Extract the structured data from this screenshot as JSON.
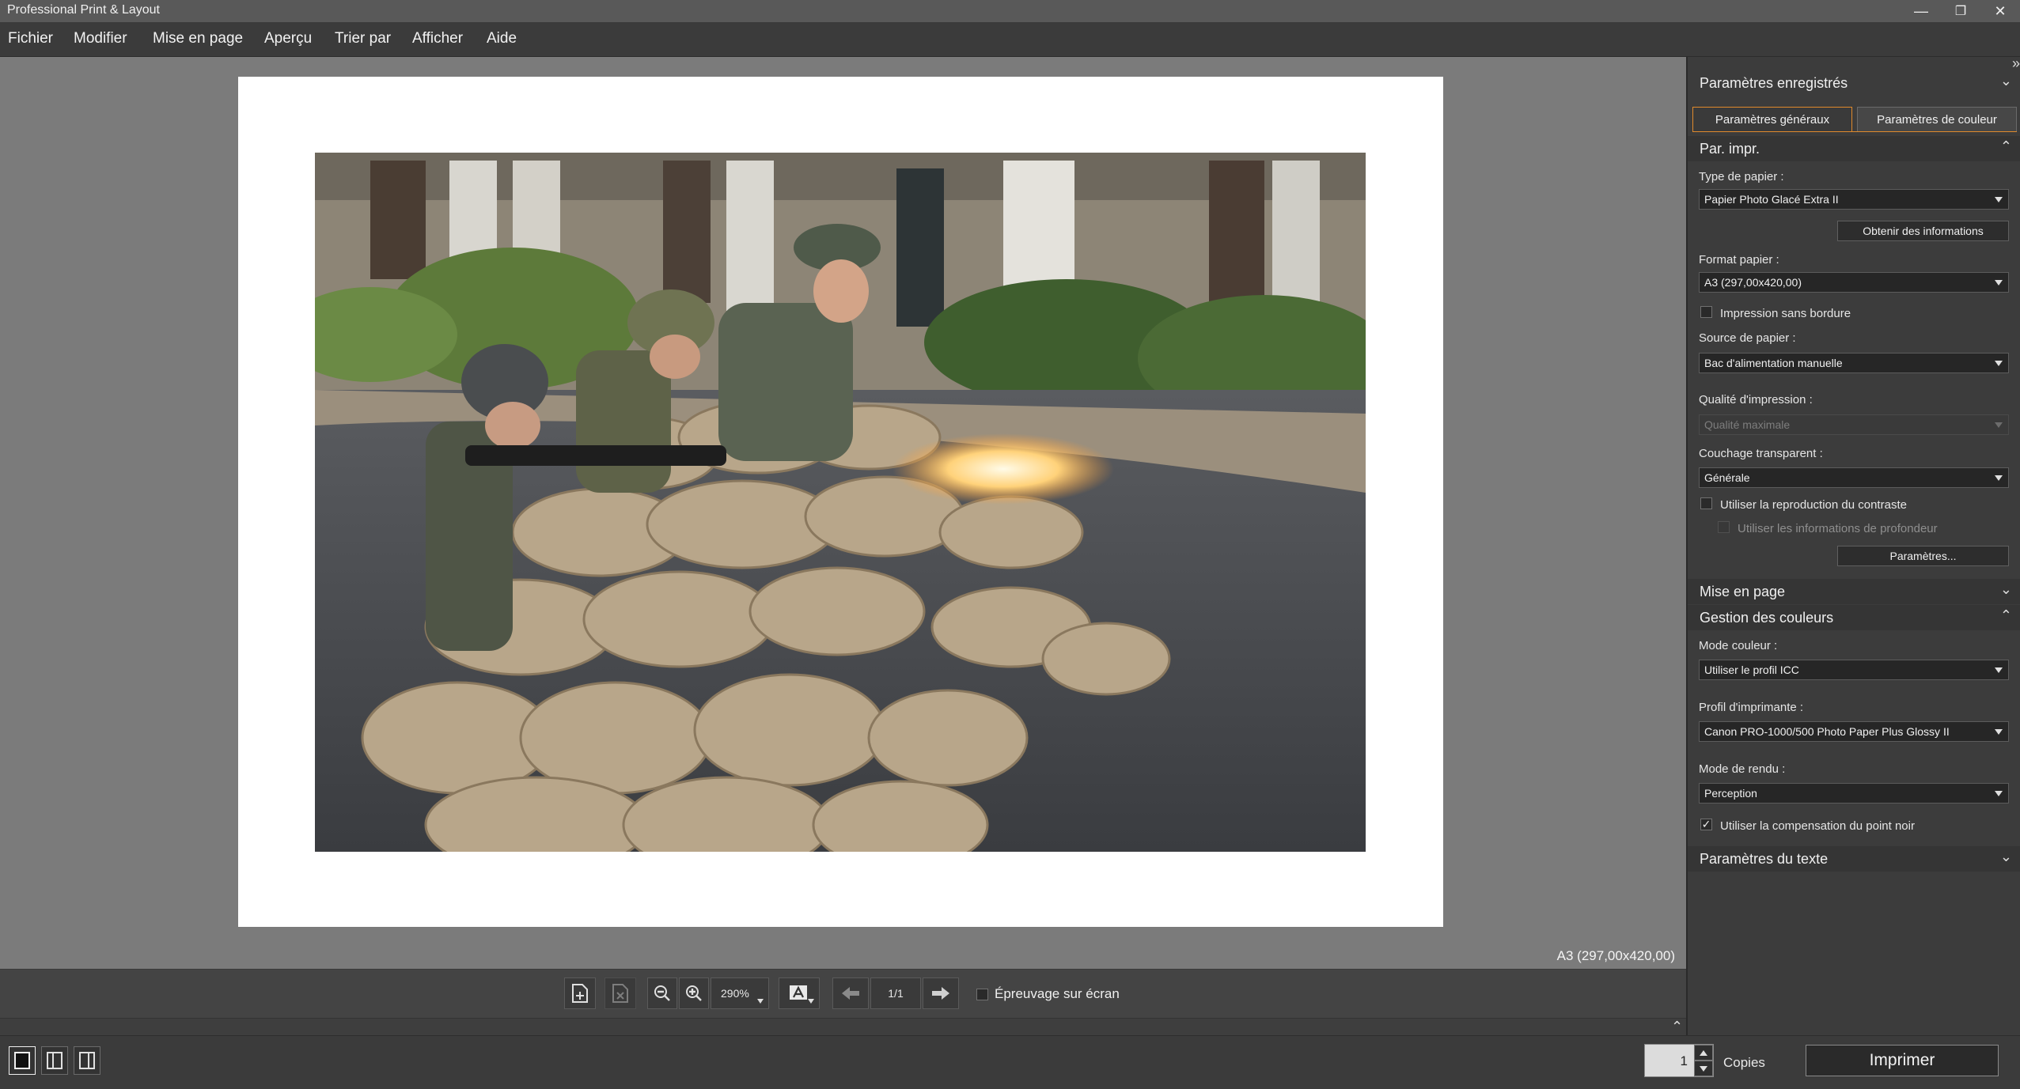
{
  "window": {
    "title": "Professional Print & Layout",
    "minimize_glyph": "—",
    "restore_glyph": "❐",
    "close_glyph": "✕"
  },
  "menu": [
    "Fichier",
    "Modifier",
    "Mise en page",
    "Aperçu",
    "Trier par",
    "Afficher",
    "Aide"
  ],
  "canvas": {
    "paper_size_label": "A3 (297,00x420,00)"
  },
  "toolbar": {
    "zoom_value": "290%",
    "page_indicator": "1/1",
    "soft_proof_label": "Épreuvage sur écran",
    "icons": [
      "add-page-icon",
      "delete-page-icon",
      "zoom-out-icon",
      "zoom-in-icon",
      "text-icon",
      "prev-page-icon",
      "next-page-icon"
    ]
  },
  "statusbar": {
    "copies_value": "1",
    "copies_label": "Copies",
    "print_label": "Imprimer"
  },
  "panel": {
    "saved_settings": "Paramètres enregistrés",
    "tabs": [
      "Paramètres généraux",
      "Paramètres de couleur"
    ],
    "print_settings": {
      "header": "Par. impr.",
      "paper_type_label": "Type de papier :",
      "paper_type_value": "Papier Photo Glacé Extra II",
      "get_info_button": "Obtenir des informations",
      "paper_size_label": "Format papier :",
      "paper_size_value": "A3 (297,00x420,00)",
      "borderless_label": "Impression sans bordure",
      "paper_source_label": "Source de papier :",
      "paper_source_value": "Bac d'alimentation manuelle",
      "print_quality_label": "Qualité d'impression :",
      "print_quality_value": "Qualité maximale",
      "clear_coating_label": "Couchage transparent :",
      "clear_coating_value": "Générale",
      "contrast_label": "Utiliser la reproduction du contraste",
      "depth_label": "Utiliser les informations de profondeur",
      "settings_button": "Paramètres..."
    },
    "layout_header": "Mise en page",
    "color_management": {
      "header": "Gestion des couleurs",
      "color_mode_label": "Mode couleur :",
      "color_mode_value": "Utiliser le profil ICC",
      "printer_profile_label": "Profil d'imprimante :",
      "printer_profile_value": "Canon PRO-1000/500 Photo Paper Plus Glossy II",
      "rendering_intent_label": "Mode de rendu :",
      "rendering_intent_value": "Perception",
      "black_point_label": "Utiliser la compensation du point noir",
      "black_point_checked": true
    },
    "text_settings_header": "Paramètres du texte"
  },
  "colors": {
    "accent_tab_border": "#e08a2c",
    "panel_bg": "#3c3c3c",
    "canvas_bg": "#7b7b7b"
  }
}
